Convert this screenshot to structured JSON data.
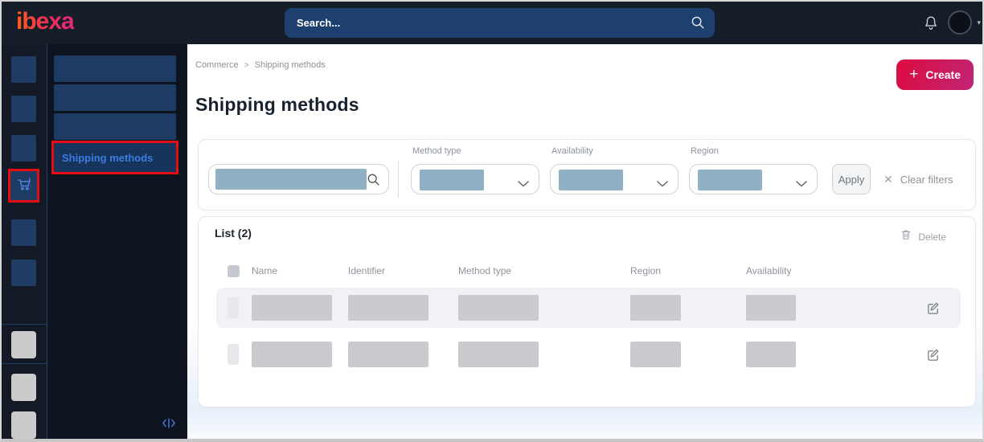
{
  "topbar": {
    "logo": "ibexa",
    "search": {
      "placeholder": "Search...",
      "icon": "magnifier"
    },
    "bell_icon": "bell",
    "user_caret": "▾"
  },
  "sidebar": {
    "active_icon": "shopping-cart",
    "selected_item": "Shipping methods",
    "collapse_icon": "collapse-horizontal"
  },
  "main": {
    "breadcrumb": {
      "item1": "Commerce",
      "separator": ">",
      "item2": "Shipping methods"
    },
    "title": "Shipping methods",
    "create_button": {
      "icon": "+",
      "label": "Create"
    },
    "filters": {
      "fields": [
        {
          "label": "Method type"
        },
        {
          "label": "Availability"
        },
        {
          "label": "Region"
        }
      ],
      "apply_label": "Apply",
      "clear": {
        "icon": "✕",
        "label": "Clear filters"
      }
    },
    "list": {
      "title": "List (2)",
      "delete_label": "Delete",
      "columns": [
        "Name",
        "Identifier",
        "Method type",
        "Region",
        "Availability"
      ],
      "row_count": 2
    }
  },
  "colors": {
    "highlight_red": "#e30d13",
    "link_blue": "#3e7be0",
    "create_gradient_start": "#dc0c3f",
    "create_gradient_end": "#c02575",
    "filter_placeholder": "#90b0c3",
    "table_placeholder": "#c9cbce"
  }
}
